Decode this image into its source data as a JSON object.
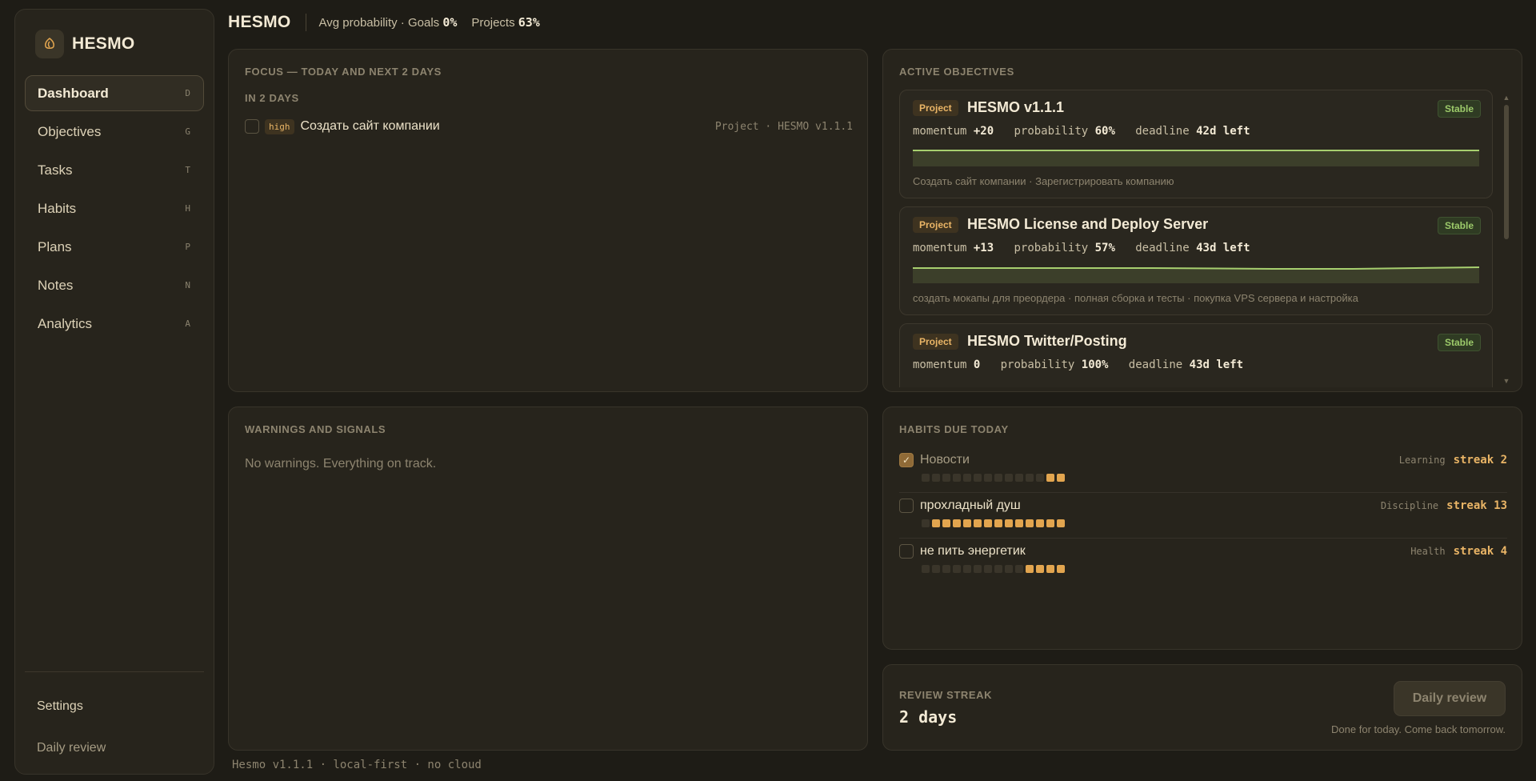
{
  "brand": {
    "name": "HESMO",
    "logo_icon": "hesmo-logo-icon"
  },
  "nav": [
    {
      "label": "Dashboard",
      "key": "D",
      "active": true
    },
    {
      "label": "Objectives",
      "key": "G"
    },
    {
      "label": "Tasks",
      "key": "T"
    },
    {
      "label": "Habits",
      "key": "H"
    },
    {
      "label": "Plans",
      "key": "P"
    },
    {
      "label": "Notes",
      "key": "N"
    },
    {
      "label": "Analytics",
      "key": "A"
    }
  ],
  "sidebar_footer": {
    "settings": "Settings",
    "daily_review": "Daily review"
  },
  "header": {
    "title": "HESMO",
    "avg_label": "Avg probability · Goals",
    "goals_value": "0%",
    "projects_label": "Projects",
    "projects_value": "63%"
  },
  "focus": {
    "title": "FOCUS — TODAY AND NEXT 2 DAYS",
    "group": "IN 2 DAYS",
    "task": {
      "priority": "high",
      "text": "Создать сайт компании",
      "meta": "Project · HESMO v1.1.1"
    }
  },
  "objectives": {
    "title": "ACTIVE OBJECTIVES",
    "items": [
      {
        "type": "Project",
        "title": "HESMO v1.1.1",
        "status": "Stable",
        "momentum": "+20",
        "probability": "60%",
        "deadline": "42d left",
        "subtitle": "Создать сайт компании · Зарегистрировать компанию"
      },
      {
        "type": "Project",
        "title": "HESMO License and Deploy Server",
        "status": "Stable",
        "momentum": "+13",
        "probability": "57%",
        "deadline": "43d left",
        "subtitle": "создать мокапы для преордера · полная сборка и тесты · покупка VPS сервера и настройка"
      },
      {
        "type": "Project",
        "title": "HESMO Twitter/Posting",
        "status": "Stable",
        "momentum": "0",
        "probability": "100%",
        "deadline": "43d left",
        "subtitle": ""
      }
    ],
    "labels": {
      "momentum": "momentum",
      "probability": "probability",
      "deadline": "deadline"
    }
  },
  "warnings": {
    "title": "WARNINGS AND SIGNALS",
    "text": "No warnings. Everything on track."
  },
  "habits": {
    "title": "HABITS DUE TODAY",
    "items": [
      {
        "name": "Новости",
        "category": "Learning",
        "streak": "streak 2",
        "done": true,
        "history": [
          0,
          0,
          0,
          0,
          0,
          0,
          0,
          0,
          0,
          0,
          0,
          0,
          1,
          1
        ]
      },
      {
        "name": "прохладный душ",
        "category": "Discipline",
        "streak": "streak 13",
        "done": false,
        "history": [
          0,
          1,
          1,
          1,
          1,
          1,
          1,
          1,
          1,
          1,
          1,
          1,
          1,
          1
        ]
      },
      {
        "name": "не пить энергетик",
        "category": "Health",
        "streak": "streak 4",
        "done": false,
        "history": [
          0,
          0,
          0,
          0,
          0,
          0,
          0,
          0,
          0,
          0,
          1,
          1,
          1,
          1
        ]
      }
    ]
  },
  "review": {
    "label": "REVIEW STREAK",
    "value": "2 days",
    "button": "Daily review",
    "note": "Done for today. Come back tomorrow."
  },
  "footer": "Hesmo v1.1.1 · local-first · no cloud",
  "colors": {
    "accent": "#e2a54f",
    "stable": "#9cca6a",
    "background": "#1e1c16"
  }
}
